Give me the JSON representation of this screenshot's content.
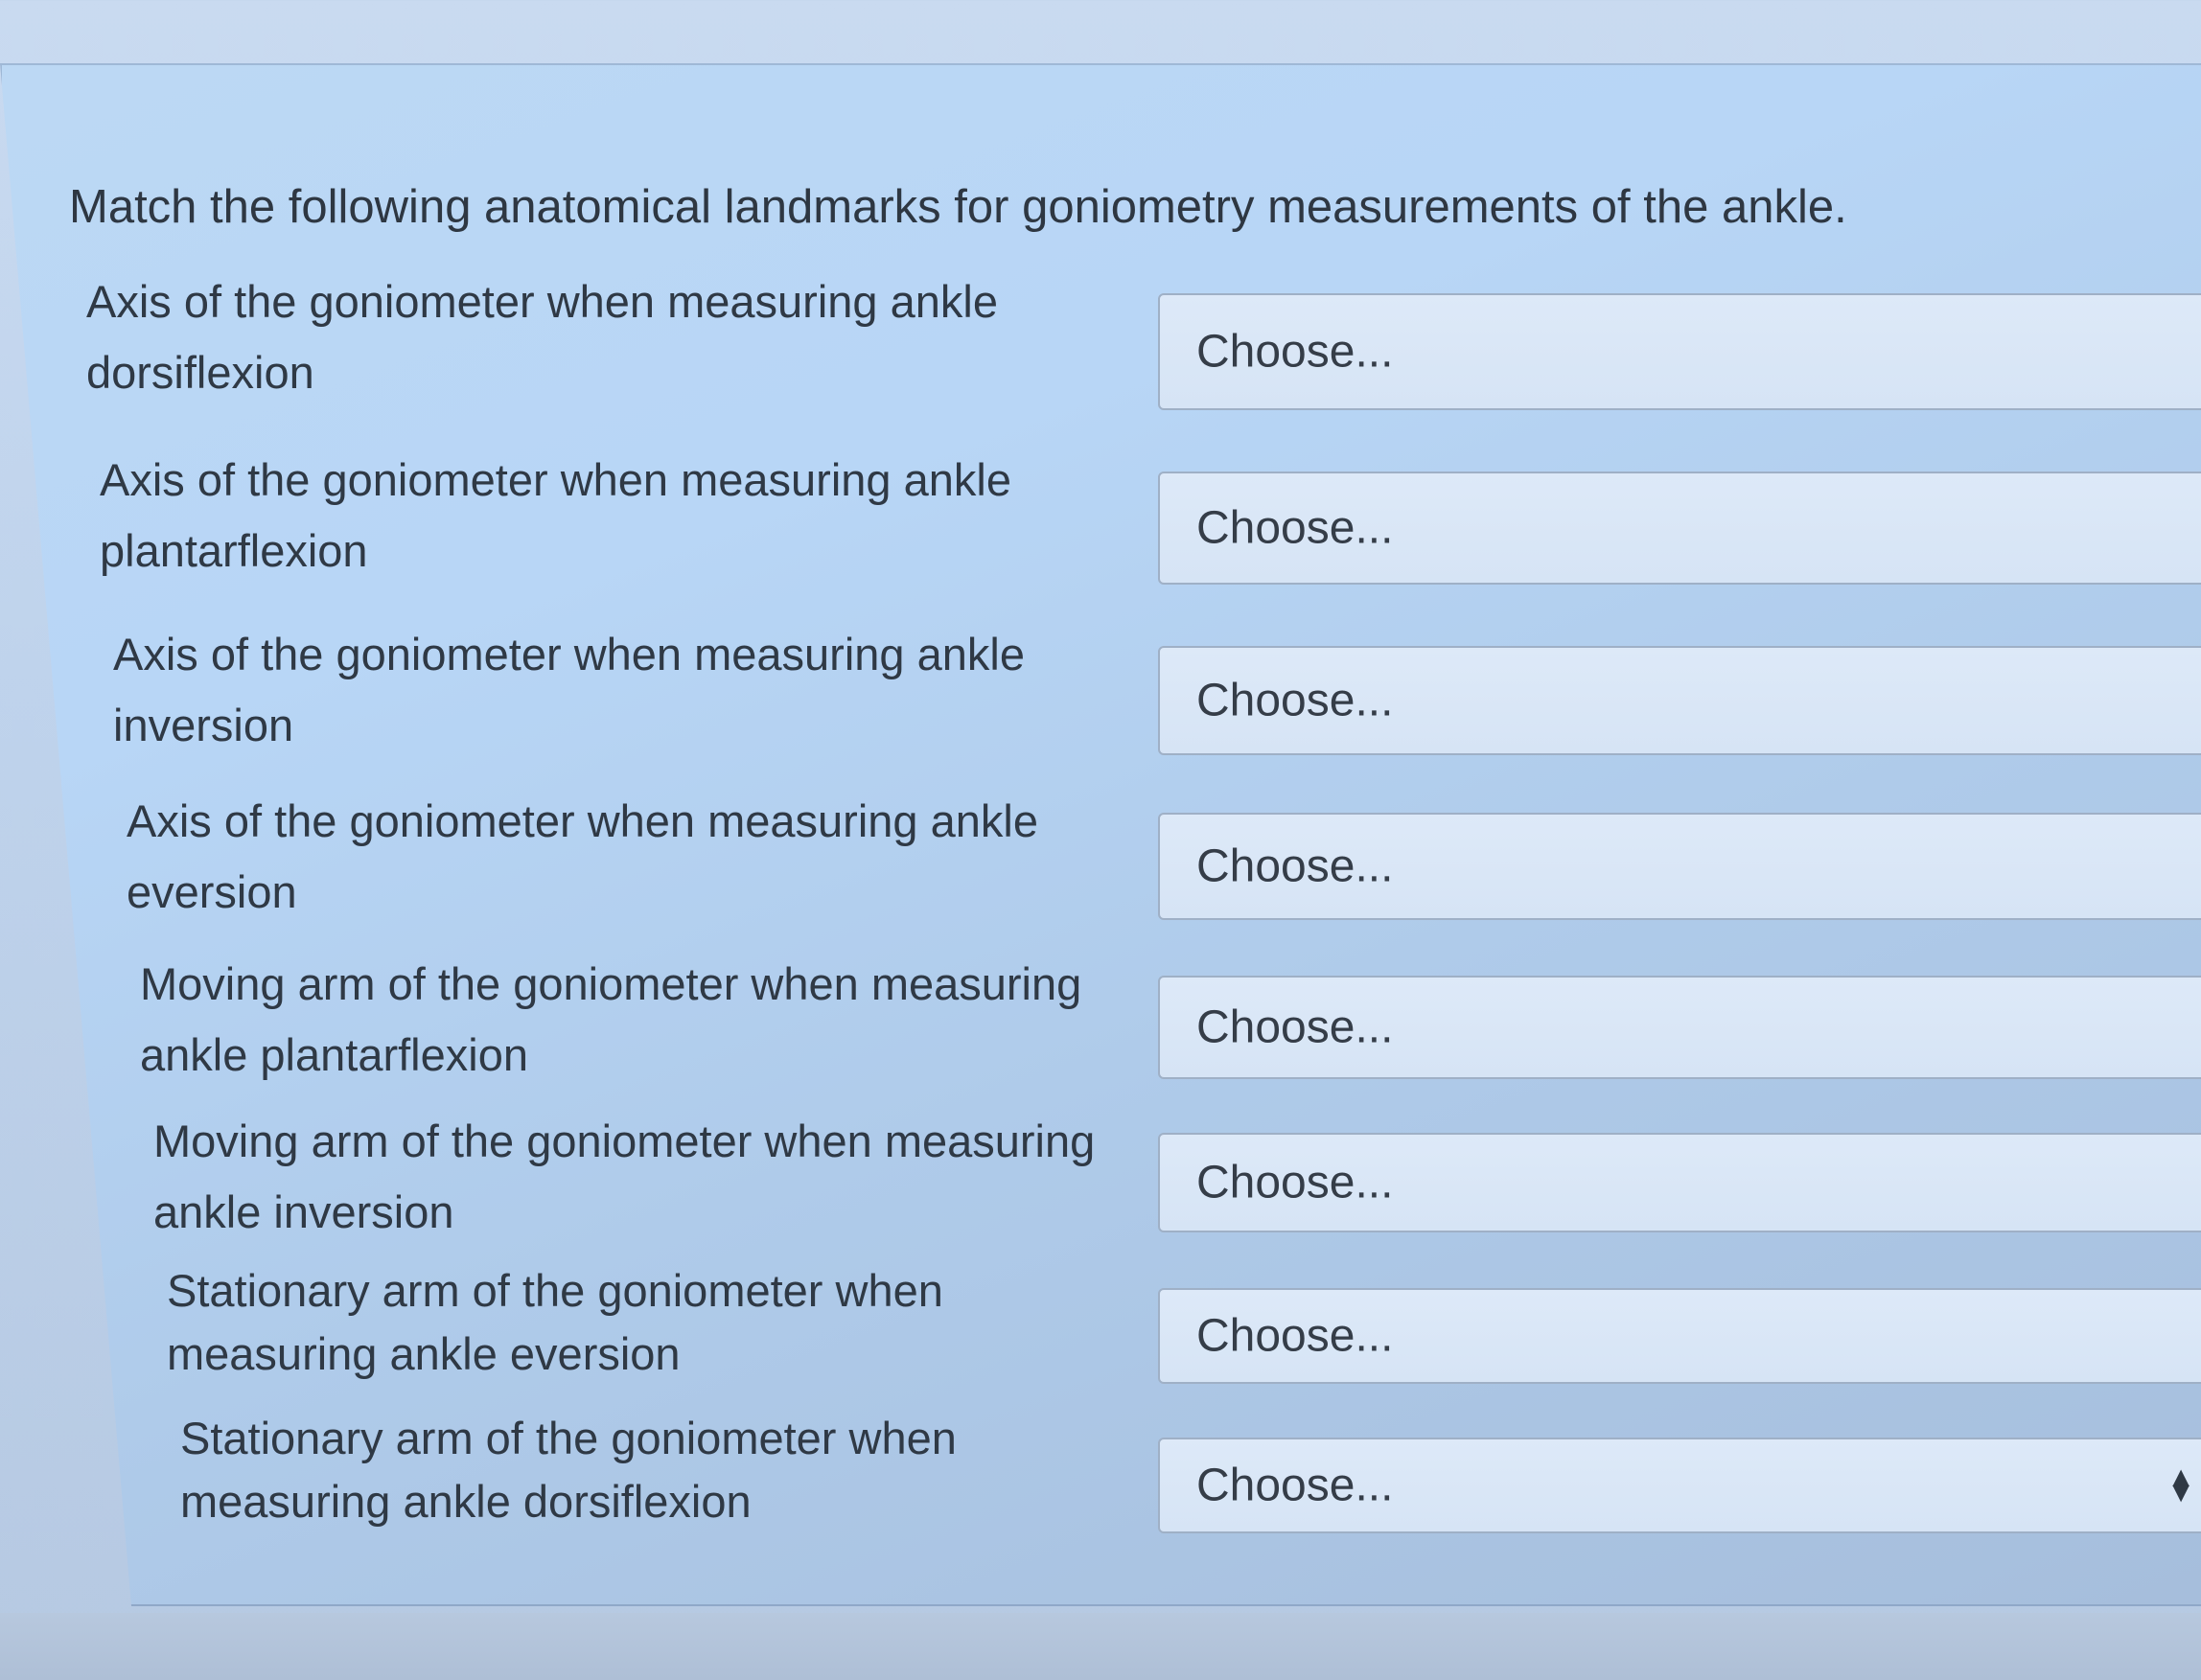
{
  "question": {
    "text": "Match the following anatomical landmarks for goniometry measurements of the ankle."
  },
  "rows": [
    {
      "line1": "Axis of the goniometer when measuring ankle",
      "line2": "dorsiflexion",
      "selected": "Choose..."
    },
    {
      "line1": "Axis of the goniometer when measuring ankle",
      "line2": "plantarflexion",
      "selected": "Choose..."
    },
    {
      "line1": "Axis of the goniometer when measuring ankle",
      "line2": "inversion",
      "selected": "Choose..."
    },
    {
      "line1": "Axis of the goniometer when measuring ankle",
      "line2": "eversion",
      "selected": "Choose..."
    },
    {
      "line1": "Moving arm of the goniometer when measuring",
      "line2": "ankle plantarflexion",
      "selected": "Choose..."
    },
    {
      "line1": "Moving arm of the goniometer when measuring",
      "line2": "ankle inversion",
      "selected": "Choose..."
    },
    {
      "line1": "Stationary arm of the goniometer when",
      "line2": "measuring ankle eversion",
      "selected": "Choose..."
    },
    {
      "line1": "Stationary arm of the goniometer when",
      "line2": "measuring ankle dorsiflexion",
      "selected": "Choose..."
    }
  ],
  "icons": {
    "select_arrow": "up-down-chevron-icon"
  }
}
